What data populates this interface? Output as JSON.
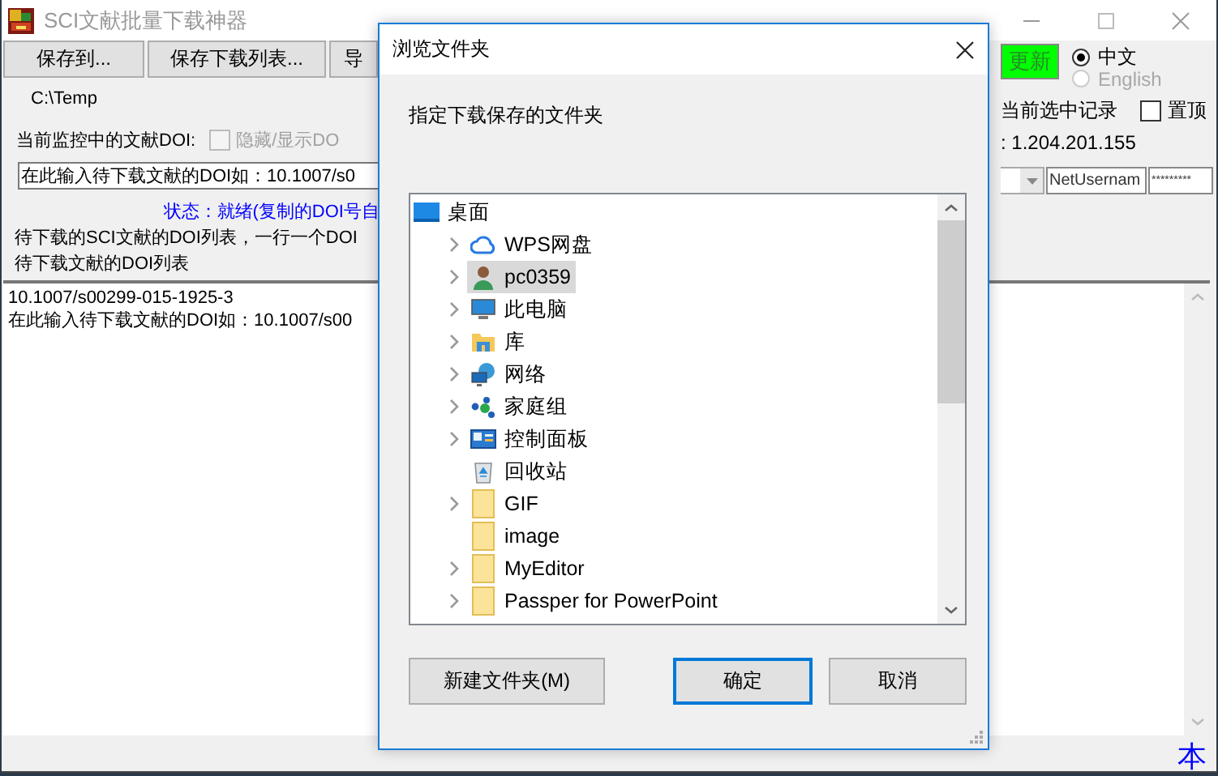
{
  "window": {
    "title": "SCI文献批量下载神器"
  },
  "toolbar": {
    "buttons": [
      "保存到...",
      "保存下载列表...",
      "导"
    ]
  },
  "save_path": "C:\\Temp",
  "monitor": {
    "label": "当前监控中的文献DOI:",
    "toggle": {
      "label": "隐藏/显示DO",
      "checked": false,
      "disabled": true
    }
  },
  "doi_input": {
    "value": "在此输入待下载文献的DOI如：10.1007/s0"
  },
  "status": "状态：就绪(复制的DOI号自",
  "list_hint": "待下载的SCI文献的DOI列表，一行一个DOI",
  "list_label": "待下载文献的DOI列表",
  "doi_list": {
    "lines": [
      "10.1007/s00299-015-1925-3",
      "在此输入待下载文献的DOI如：10.1007/s00"
    ]
  },
  "update_button": "更新",
  "languages": [
    {
      "label": "中文",
      "selected": true,
      "disabled": false
    },
    {
      "label": "English",
      "selected": false,
      "disabled": true
    }
  ],
  "current_record": "当前选中记录",
  "pin": {
    "label": "置顶",
    "checked": false
  },
  "ip": ": 1.204.201.155",
  "net_username": {
    "value": "NetUsernam"
  },
  "net_password": {
    "value": "*********"
  },
  "corner_text": "本",
  "dialog": {
    "title": "浏览文件夹",
    "prompt": "指定下载保存的文件夹",
    "tree": [
      {
        "label": "桌面",
        "kind": "desktop",
        "expandable": false,
        "selected": false,
        "children": [
          {
            "label": "WPS网盘",
            "kind": "cloud",
            "expandable": true,
            "selected": false
          },
          {
            "label": "pc0359",
            "kind": "user",
            "expandable": true,
            "selected": true
          },
          {
            "label": "此电脑",
            "kind": "computer",
            "expandable": true,
            "selected": false
          },
          {
            "label": "库",
            "kind": "library",
            "expandable": true,
            "selected": false
          },
          {
            "label": "网络",
            "kind": "network",
            "expandable": true,
            "selected": false
          },
          {
            "label": "家庭组",
            "kind": "homegroup",
            "expandable": true,
            "selected": false
          },
          {
            "label": "控制面板",
            "kind": "control-panel",
            "expandable": true,
            "selected": false
          },
          {
            "label": "回收站",
            "kind": "recycle",
            "expandable": false,
            "selected": false
          },
          {
            "label": "GIF",
            "kind": "folder",
            "expandable": true,
            "selected": false
          },
          {
            "label": "image",
            "kind": "folder",
            "expandable": false,
            "selected": false
          },
          {
            "label": "MyEditor",
            "kind": "folder",
            "expandable": true,
            "selected": false
          },
          {
            "label": "Passper for PowerPoint",
            "kind": "folder",
            "expandable": true,
            "selected": false
          }
        ]
      }
    ],
    "buttons": [
      {
        "label": "新建文件夹(M)",
        "default": false
      },
      {
        "label": "确定",
        "default": true
      },
      {
        "label": "取消",
        "default": false
      }
    ]
  }
}
